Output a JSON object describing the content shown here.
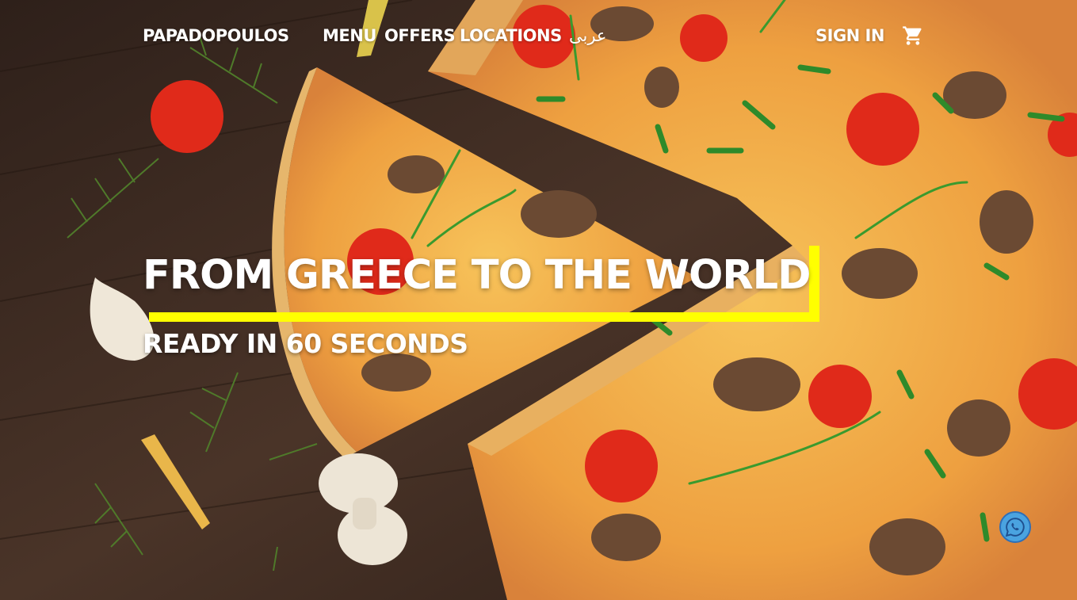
{
  "nav": {
    "brand": "PAPADOPOULOS",
    "menu": "MENU",
    "offers": "OFFERS",
    "locations": "LOCATIONS",
    "language": "عربى",
    "sign_in": "SIGN IN",
    "cart_icon": "shopping-cart-icon"
  },
  "hero": {
    "title": "FROM GREECE TO THE WORLD",
    "subtitle": "READY IN 60 SECONDS",
    "accent_color": "#ffff00"
  },
  "chat": {
    "icon": "whatsapp-icon",
    "color": "#4aa3e0"
  }
}
